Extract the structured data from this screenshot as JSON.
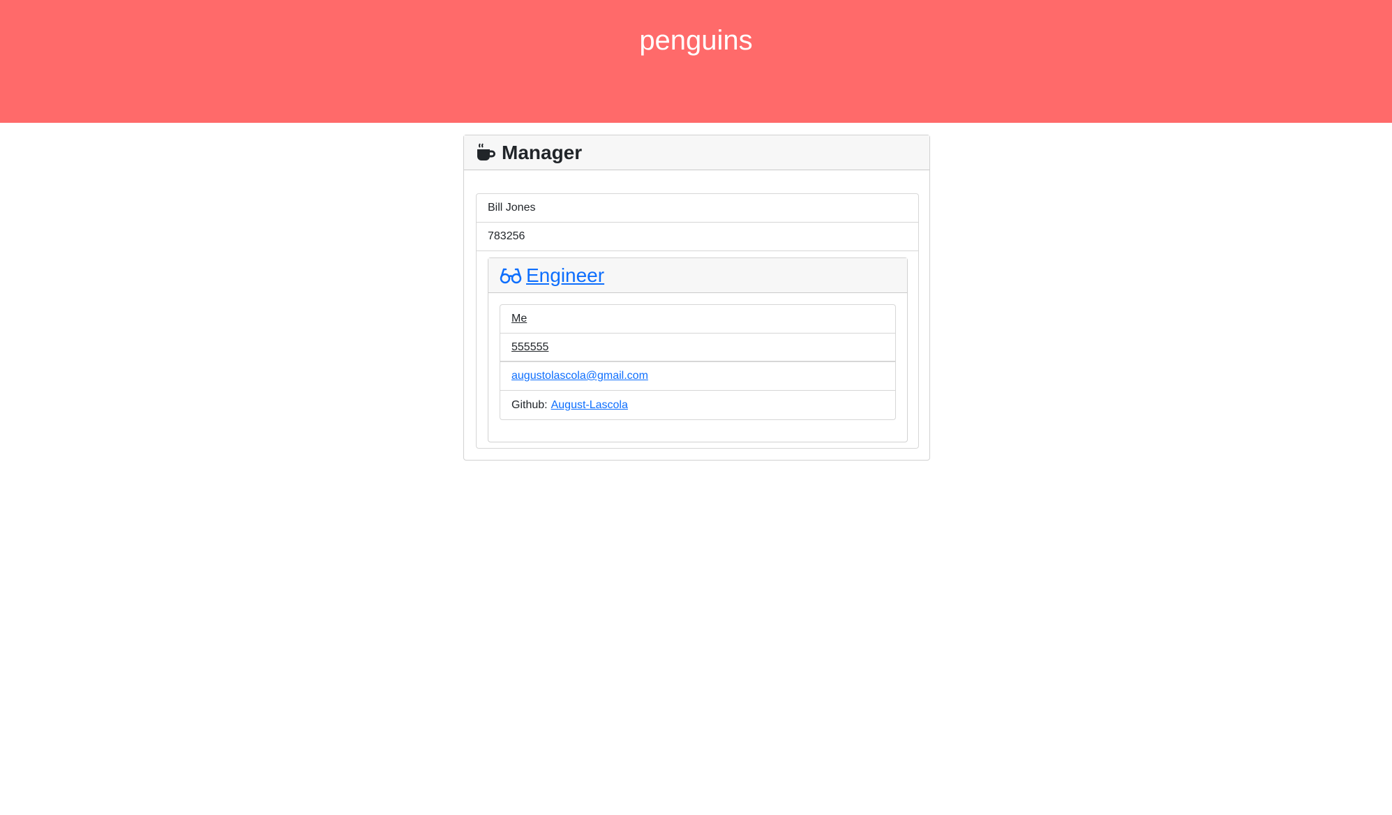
{
  "header": {
    "title": "penguins"
  },
  "manager": {
    "role": "Manager",
    "icon": "coffee-mug-icon",
    "name": "Bill Jones",
    "id": "783256"
  },
  "engineer": {
    "role": "Engineer",
    "icon": "glasses-icon",
    "name": "Me",
    "id": "555555",
    "email": "augustolascola@gmail.com",
    "github_prefix": "Github:",
    "github_user": "August-Lascola"
  },
  "colors": {
    "header_bg": "#ff6a6a",
    "link": "#0d6efd"
  }
}
